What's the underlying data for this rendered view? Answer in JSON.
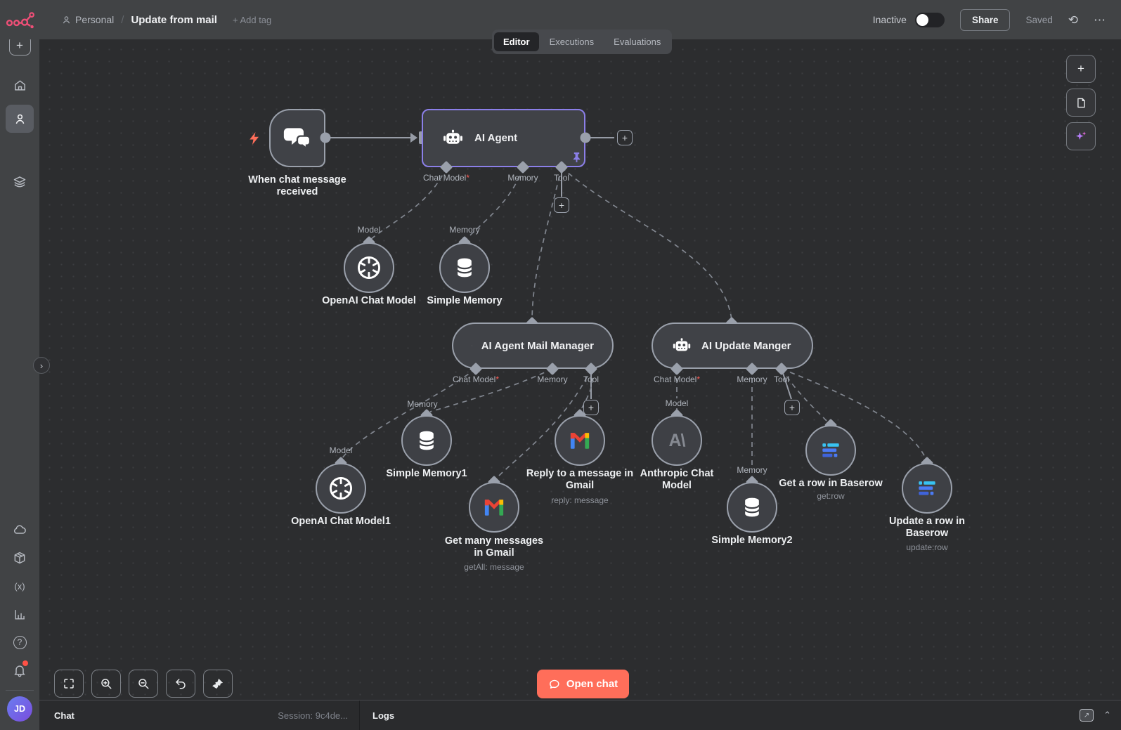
{
  "topbar": {
    "project": "Personal",
    "separator": "/",
    "workflow_title": "Update from mail",
    "add_tag": "+ Add tag",
    "activation_status": "Inactive",
    "share_label": "Share",
    "saved_label": "Saved"
  },
  "tabs": {
    "editor": "Editor",
    "executions": "Executions",
    "evaluations": "Evaluations"
  },
  "icons": {
    "plus": "+",
    "ellipsis": "⋯",
    "history": "⟲",
    "chevron_right": "›",
    "chevron_up": "⌃",
    "help": "?",
    "variables": "(x)",
    "anthropic": "A\\",
    "asterisk": "*",
    "popout_arrow": "↗"
  },
  "avatar_initials": "JD",
  "canvas": {
    "trigger": {
      "label": "When chat message received"
    },
    "agent": {
      "label": "AI Agent",
      "ports": {
        "chat_model": "Chat Model",
        "memory": "Memory",
        "tool": "Tool"
      }
    },
    "mail_agent": {
      "label": "AI Agent Mail Manager",
      "ports": {
        "chat_model": "Chat Model",
        "memory": "Memory",
        "tool": "Tool"
      }
    },
    "update_agent": {
      "label": "AI Update Manger",
      "ports": {
        "chat_model": "Chat Model",
        "memory": "Memory",
        "tool": "Tool"
      }
    },
    "openai": {
      "port": "Model",
      "label": "OpenAI Chat Model"
    },
    "memory": {
      "port": "Memory",
      "label": "Simple Memory"
    },
    "openai1": {
      "port": "Model",
      "label": "OpenAI Chat Model1"
    },
    "memory1": {
      "port": "Memory",
      "label": "Simple Memory1"
    },
    "gmail_get": {
      "label": "Get many messages in Gmail",
      "operation": "getAll: message"
    },
    "gmail_reply": {
      "label": "Reply to a message in Gmail",
      "operation": "reply: message"
    },
    "anthropic": {
      "port": "Model",
      "label": "Anthropic Chat Model"
    },
    "memory2": {
      "port": "Memory",
      "label": "Simple Memory2"
    },
    "baserow_get": {
      "label": "Get a row in Baserow",
      "operation": "get:row"
    },
    "baserow_update": {
      "label": "Update a row in Baserow",
      "operation": "update:row"
    },
    "open_chat_label": "Open chat"
  },
  "bottombar": {
    "chat": "Chat",
    "session": "Session: 9c4de...",
    "logs": "Logs"
  },
  "colors": {
    "accent": "#ff6e5a",
    "selected_border": "#8b7fe8",
    "brand": "#ea4b71",
    "canvas": "#2c2d2f"
  }
}
